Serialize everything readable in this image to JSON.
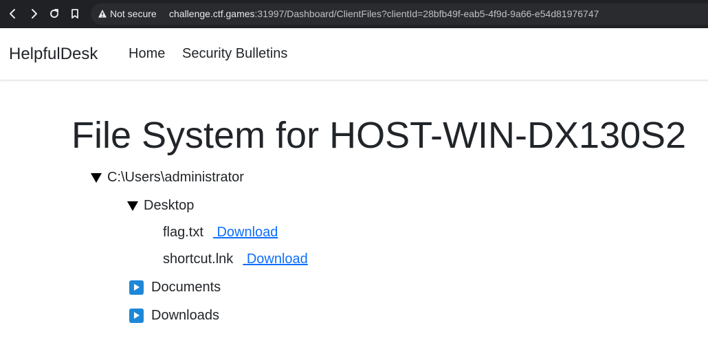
{
  "browser": {
    "security_label": "Not secure",
    "url_host": "challenge.ctf.games",
    "url_rest": ":31997/Dashboard/ClientFiles?clientId=28bfb49f-eab5-4f9d-9a66-e54d81976747"
  },
  "navbar": {
    "brand": "HelpfulDesk",
    "links": [
      "Home",
      "Security Bulletins"
    ]
  },
  "main": {
    "title": "File System for HOST-WIN-DX130S2",
    "root_folder": "C:\\Users\\administrator",
    "desktop_folder": "Desktop",
    "files": [
      {
        "name": "flag.txt",
        "action": " Download"
      },
      {
        "name": "shortcut.lnk",
        "action": " Download"
      }
    ],
    "collapsed_folders": [
      "Documents",
      "Downloads"
    ]
  },
  "colors": {
    "chrome_bg": "#202124",
    "link": "#0d6efd",
    "folder_toggle": "#1e88d8",
    "text": "#212529"
  }
}
